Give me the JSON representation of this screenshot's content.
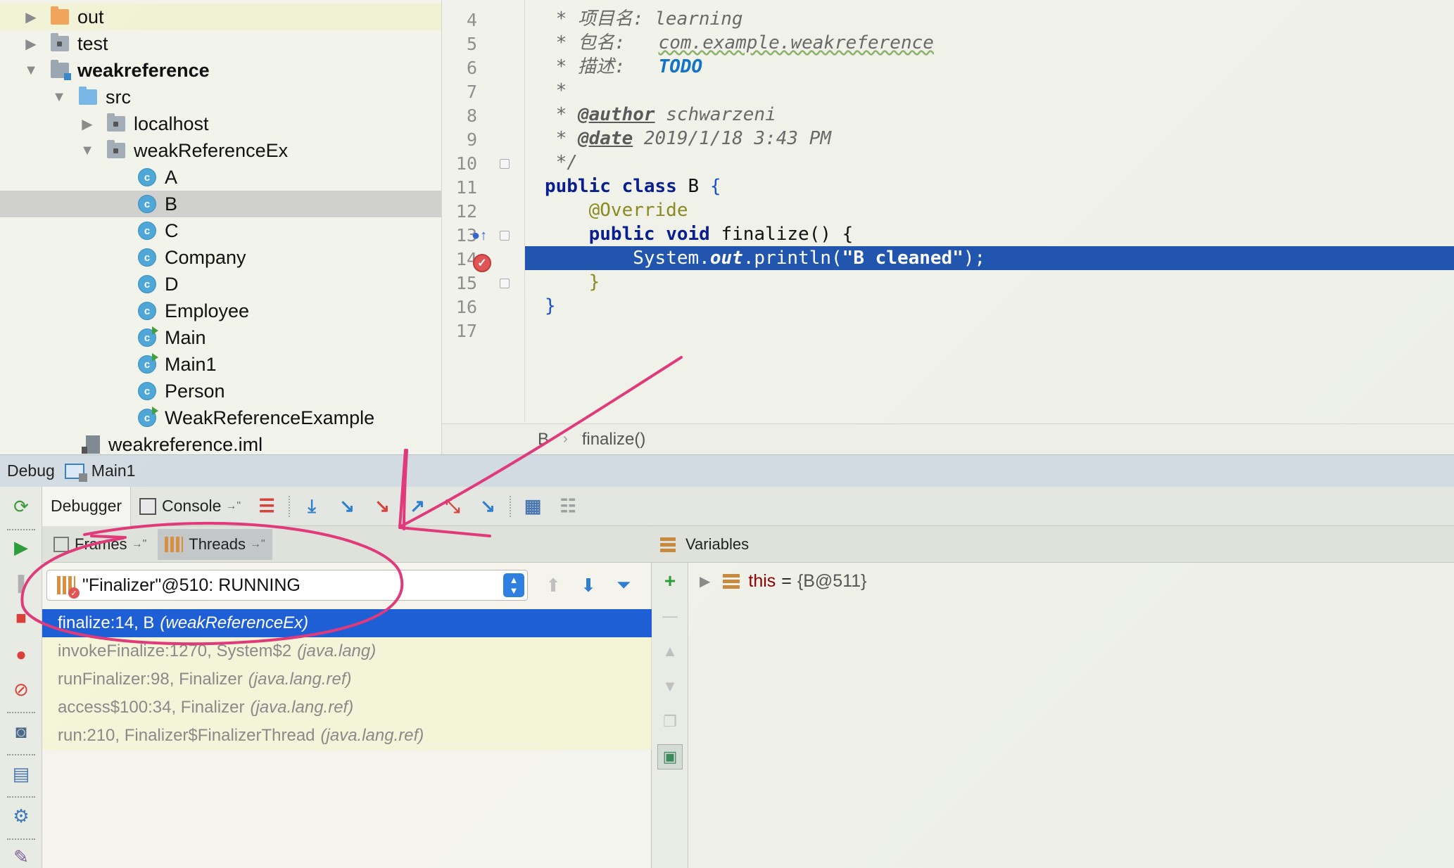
{
  "project_tree": {
    "items": [
      {
        "label": "out",
        "icon": "folder-orange-icon",
        "arrow": "▶"
      },
      {
        "label": "test",
        "icon": "folder-icon",
        "arrow": "▶"
      },
      {
        "label": "weakreference",
        "icon": "module-folder-icon",
        "arrow": "▼"
      },
      {
        "label": "src",
        "icon": "source-folder-icon",
        "arrow": "▼"
      },
      {
        "label": "localhost",
        "icon": "package-icon",
        "arrow": "▶"
      },
      {
        "label": "weakReferenceEx",
        "icon": "package-icon",
        "arrow": "▼"
      },
      {
        "label": "A",
        "icon": "class-icon"
      },
      {
        "label": "B",
        "icon": "class-icon"
      },
      {
        "label": "C",
        "icon": "class-icon"
      },
      {
        "label": "Company",
        "icon": "class-icon"
      },
      {
        "label": "D",
        "icon": "class-icon"
      },
      {
        "label": "Employee",
        "icon": "class-icon"
      },
      {
        "label": "Main",
        "icon": "runnable-class-icon"
      },
      {
        "label": "Main1",
        "icon": "runnable-class-icon"
      },
      {
        "label": "Person",
        "icon": "class-icon"
      },
      {
        "label": "WeakReferenceExample",
        "icon": "runnable-class-icon"
      },
      {
        "label": "weakreference.iml",
        "icon": "iml-file-icon"
      }
    ],
    "class_icon_letter": "c"
  },
  "editor": {
    "line_numbers": [
      "4",
      "5",
      "6",
      "7",
      "8",
      "9",
      "10",
      "11",
      "12",
      "13",
      "14",
      "15",
      "16",
      "17"
    ],
    "code": {
      "l4_prefix": " * 项目名: ",
      "l4_value": "learning",
      "l5_prefix": " * 包名:   ",
      "l5_value": "com.example.weakreference",
      "l6_prefix": " * 描述:   ",
      "l6_value": "TODO",
      "l7": " *",
      "l8_prefix": " * ",
      "l8_tag": "@author",
      "l8_value": " schwarzeni",
      "l9_prefix": " * ",
      "l9_tag": "@date",
      "l9_value": " 2019/1/18 3:43 PM",
      "l10": " */",
      "l11_kw": "public class",
      "l11_name": " B ",
      "l11_brace": "{",
      "l12": "    @Override",
      "l13_indent": "    ",
      "l13_kw": "public void",
      "l13_rest": " finalize() {",
      "l14_indent": "        ",
      "l14_a": "System.",
      "l14_b": "out",
      "l14_c": ".println(",
      "l14_str": "\"B cleaned\"",
      "l14_d": ");",
      "l15": "    }",
      "l16": "}",
      "l17": ""
    },
    "breakpoint_line": "14",
    "breadcrumb": [
      "B",
      "finalize()"
    ]
  },
  "debug": {
    "title": "Debug",
    "run_config": "Main1",
    "tabs": [
      {
        "label": "Debugger"
      },
      {
        "label": "Console"
      }
    ],
    "frames": {
      "tabs": [
        {
          "label": "Frames"
        },
        {
          "label": "Threads"
        }
      ],
      "thread_selector": "\"Finalizer\"@510: RUNNING",
      "rows": [
        {
          "method": "finalize:14, B",
          "pkg": "(weakReferenceEx)"
        },
        {
          "method": "invokeFinalize:1270, System$2",
          "pkg": "(java.lang)"
        },
        {
          "method": "runFinalizer:98, Finalizer",
          "pkg": "(java.lang.ref)"
        },
        {
          "method": "access$100:34, Finalizer",
          "pkg": "(java.lang.ref)"
        },
        {
          "method": "run:210, Finalizer$FinalizerThread",
          "pkg": "(java.lang.ref)"
        }
      ]
    },
    "variables": {
      "title": "Variables",
      "items": [
        {
          "name": "this",
          "eq": "=",
          "value": "{B@511}"
        }
      ]
    }
  },
  "colors": {
    "selection_blue": "#1f5fd6",
    "editor_highlight": "#2155ae",
    "annotation_pink": "#e03a7a"
  }
}
